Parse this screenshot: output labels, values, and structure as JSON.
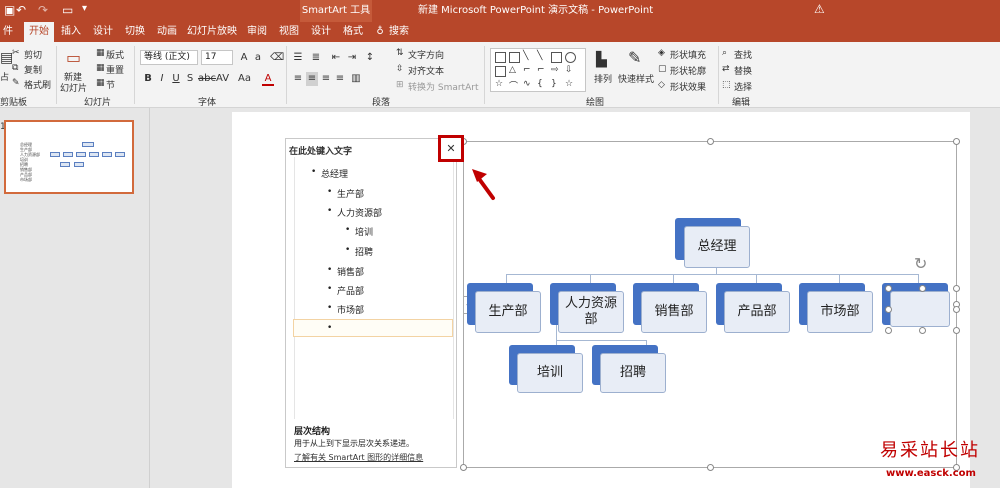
{
  "titlebar": {
    "context_tab": "SmartArt 工具",
    "document_title": "新建 Microsoft PowerPoint 演示文稿 - PowerPoint"
  },
  "tabs": [
    "件",
    "开始",
    "插入",
    "设计",
    "切换",
    "动画",
    "幻灯片放映",
    "审阅",
    "视图",
    "设计",
    "格式"
  ],
  "tell_me": "搜索",
  "ribbon": {
    "clipboard": {
      "label": "剪贴板",
      "cut": "剪切",
      "copy": "复制",
      "format_painter": "格式刷",
      "paste_partial": "占"
    },
    "slides": {
      "label": "幻灯片",
      "new_slide": "新建",
      "new_slide2": "幻灯片",
      "layout": "版式",
      "reset": "重置",
      "section": "节"
    },
    "font": {
      "label": "字体",
      "font_name": "等线 (正文)",
      "font_size": "17"
    },
    "paragraph": {
      "label": "段落",
      "text_direction": "文字方向",
      "align_text": "对齐文本",
      "convert": "转换为 SmartArt"
    },
    "drawing": {
      "label": "绘图",
      "arrange": "排列",
      "quick_styles": "快速样式",
      "fill": "形状填充",
      "outline": "形状轮廓",
      "effects": "形状效果"
    },
    "editing": {
      "label": "编辑",
      "find": "查找",
      "replace": "替换",
      "select": "选择"
    }
  },
  "textpane": {
    "title": "在此处键入文字",
    "items": [
      "总经理",
      "生产部",
      "人力资源部",
      "培训",
      "招聘",
      "销售部",
      "产品部",
      "市场部",
      ""
    ],
    "info_heading": "层次结构",
    "info_desc": "用于从上到下显示层次关系递进。",
    "info_link": "了解有关 SmartArt 图形的详细信息"
  },
  "smartart": {
    "top": "总经理",
    "row2": [
      "生产部",
      "人力资源部",
      "销售部",
      "产品部",
      "市场部",
      ""
    ],
    "row3": [
      "培训",
      "招聘"
    ]
  },
  "watermark": {
    "text": "易采站长站",
    "url": "www.easck.com"
  },
  "colors": {
    "accent": "#b7472a",
    "node_back": "#4472c4",
    "node_front": "#e8edf6",
    "annotation": "#c00000"
  }
}
